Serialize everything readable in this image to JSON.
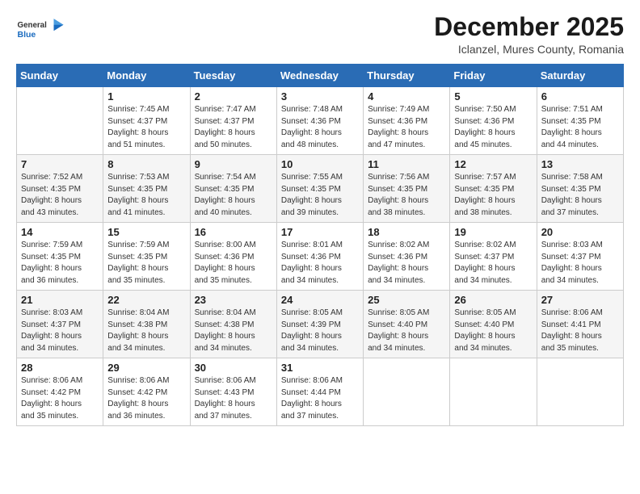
{
  "logo": {
    "general": "General",
    "blue": "Blue"
  },
  "title": "December 2025",
  "location": "Iclanzel, Mures County, Romania",
  "days_of_week": [
    "Sunday",
    "Monday",
    "Tuesday",
    "Wednesday",
    "Thursday",
    "Friday",
    "Saturday"
  ],
  "weeks": [
    [
      {
        "day": "",
        "sunrise": "",
        "sunset": "",
        "daylight": ""
      },
      {
        "day": "1",
        "sunrise": "Sunrise: 7:45 AM",
        "sunset": "Sunset: 4:37 PM",
        "daylight": "Daylight: 8 hours and 51 minutes."
      },
      {
        "day": "2",
        "sunrise": "Sunrise: 7:47 AM",
        "sunset": "Sunset: 4:37 PM",
        "daylight": "Daylight: 8 hours and 50 minutes."
      },
      {
        "day": "3",
        "sunrise": "Sunrise: 7:48 AM",
        "sunset": "Sunset: 4:36 PM",
        "daylight": "Daylight: 8 hours and 48 minutes."
      },
      {
        "day": "4",
        "sunrise": "Sunrise: 7:49 AM",
        "sunset": "Sunset: 4:36 PM",
        "daylight": "Daylight: 8 hours and 47 minutes."
      },
      {
        "day": "5",
        "sunrise": "Sunrise: 7:50 AM",
        "sunset": "Sunset: 4:36 PM",
        "daylight": "Daylight: 8 hours and 45 minutes."
      },
      {
        "day": "6",
        "sunrise": "Sunrise: 7:51 AM",
        "sunset": "Sunset: 4:35 PM",
        "daylight": "Daylight: 8 hours and 44 minutes."
      }
    ],
    [
      {
        "day": "7",
        "sunrise": "Sunrise: 7:52 AM",
        "sunset": "Sunset: 4:35 PM",
        "daylight": "Daylight: 8 hours and 43 minutes."
      },
      {
        "day": "8",
        "sunrise": "Sunrise: 7:53 AM",
        "sunset": "Sunset: 4:35 PM",
        "daylight": "Daylight: 8 hours and 41 minutes."
      },
      {
        "day": "9",
        "sunrise": "Sunrise: 7:54 AM",
        "sunset": "Sunset: 4:35 PM",
        "daylight": "Daylight: 8 hours and 40 minutes."
      },
      {
        "day": "10",
        "sunrise": "Sunrise: 7:55 AM",
        "sunset": "Sunset: 4:35 PM",
        "daylight": "Daylight: 8 hours and 39 minutes."
      },
      {
        "day": "11",
        "sunrise": "Sunrise: 7:56 AM",
        "sunset": "Sunset: 4:35 PM",
        "daylight": "Daylight: 8 hours and 38 minutes."
      },
      {
        "day": "12",
        "sunrise": "Sunrise: 7:57 AM",
        "sunset": "Sunset: 4:35 PM",
        "daylight": "Daylight: 8 hours and 38 minutes."
      },
      {
        "day": "13",
        "sunrise": "Sunrise: 7:58 AM",
        "sunset": "Sunset: 4:35 PM",
        "daylight": "Daylight: 8 hours and 37 minutes."
      }
    ],
    [
      {
        "day": "14",
        "sunrise": "Sunrise: 7:59 AM",
        "sunset": "Sunset: 4:35 PM",
        "daylight": "Daylight: 8 hours and 36 minutes."
      },
      {
        "day": "15",
        "sunrise": "Sunrise: 7:59 AM",
        "sunset": "Sunset: 4:35 PM",
        "daylight": "Daylight: 8 hours and 35 minutes."
      },
      {
        "day": "16",
        "sunrise": "Sunrise: 8:00 AM",
        "sunset": "Sunset: 4:36 PM",
        "daylight": "Daylight: 8 hours and 35 minutes."
      },
      {
        "day": "17",
        "sunrise": "Sunrise: 8:01 AM",
        "sunset": "Sunset: 4:36 PM",
        "daylight": "Daylight: 8 hours and 34 minutes."
      },
      {
        "day": "18",
        "sunrise": "Sunrise: 8:02 AM",
        "sunset": "Sunset: 4:36 PM",
        "daylight": "Daylight: 8 hours and 34 minutes."
      },
      {
        "day": "19",
        "sunrise": "Sunrise: 8:02 AM",
        "sunset": "Sunset: 4:37 PM",
        "daylight": "Daylight: 8 hours and 34 minutes."
      },
      {
        "day": "20",
        "sunrise": "Sunrise: 8:03 AM",
        "sunset": "Sunset: 4:37 PM",
        "daylight": "Daylight: 8 hours and 34 minutes."
      }
    ],
    [
      {
        "day": "21",
        "sunrise": "Sunrise: 8:03 AM",
        "sunset": "Sunset: 4:37 PM",
        "daylight": "Daylight: 8 hours and 34 minutes."
      },
      {
        "day": "22",
        "sunrise": "Sunrise: 8:04 AM",
        "sunset": "Sunset: 4:38 PM",
        "daylight": "Daylight: 8 hours and 34 minutes."
      },
      {
        "day": "23",
        "sunrise": "Sunrise: 8:04 AM",
        "sunset": "Sunset: 4:38 PM",
        "daylight": "Daylight: 8 hours and 34 minutes."
      },
      {
        "day": "24",
        "sunrise": "Sunrise: 8:05 AM",
        "sunset": "Sunset: 4:39 PM",
        "daylight": "Daylight: 8 hours and 34 minutes."
      },
      {
        "day": "25",
        "sunrise": "Sunrise: 8:05 AM",
        "sunset": "Sunset: 4:40 PM",
        "daylight": "Daylight: 8 hours and 34 minutes."
      },
      {
        "day": "26",
        "sunrise": "Sunrise: 8:05 AM",
        "sunset": "Sunset: 4:40 PM",
        "daylight": "Daylight: 8 hours and 34 minutes."
      },
      {
        "day": "27",
        "sunrise": "Sunrise: 8:06 AM",
        "sunset": "Sunset: 4:41 PM",
        "daylight": "Daylight: 8 hours and 35 minutes."
      }
    ],
    [
      {
        "day": "28",
        "sunrise": "Sunrise: 8:06 AM",
        "sunset": "Sunset: 4:42 PM",
        "daylight": "Daylight: 8 hours and 35 minutes."
      },
      {
        "day": "29",
        "sunrise": "Sunrise: 8:06 AM",
        "sunset": "Sunset: 4:42 PM",
        "daylight": "Daylight: 8 hours and 36 minutes."
      },
      {
        "day": "30",
        "sunrise": "Sunrise: 8:06 AM",
        "sunset": "Sunset: 4:43 PM",
        "daylight": "Daylight: 8 hours and 37 minutes."
      },
      {
        "day": "31",
        "sunrise": "Sunrise: 8:06 AM",
        "sunset": "Sunset: 4:44 PM",
        "daylight": "Daylight: 8 hours and 37 minutes."
      },
      {
        "day": "",
        "sunrise": "",
        "sunset": "",
        "daylight": ""
      },
      {
        "day": "",
        "sunrise": "",
        "sunset": "",
        "daylight": ""
      },
      {
        "day": "",
        "sunrise": "",
        "sunset": "",
        "daylight": ""
      }
    ]
  ]
}
